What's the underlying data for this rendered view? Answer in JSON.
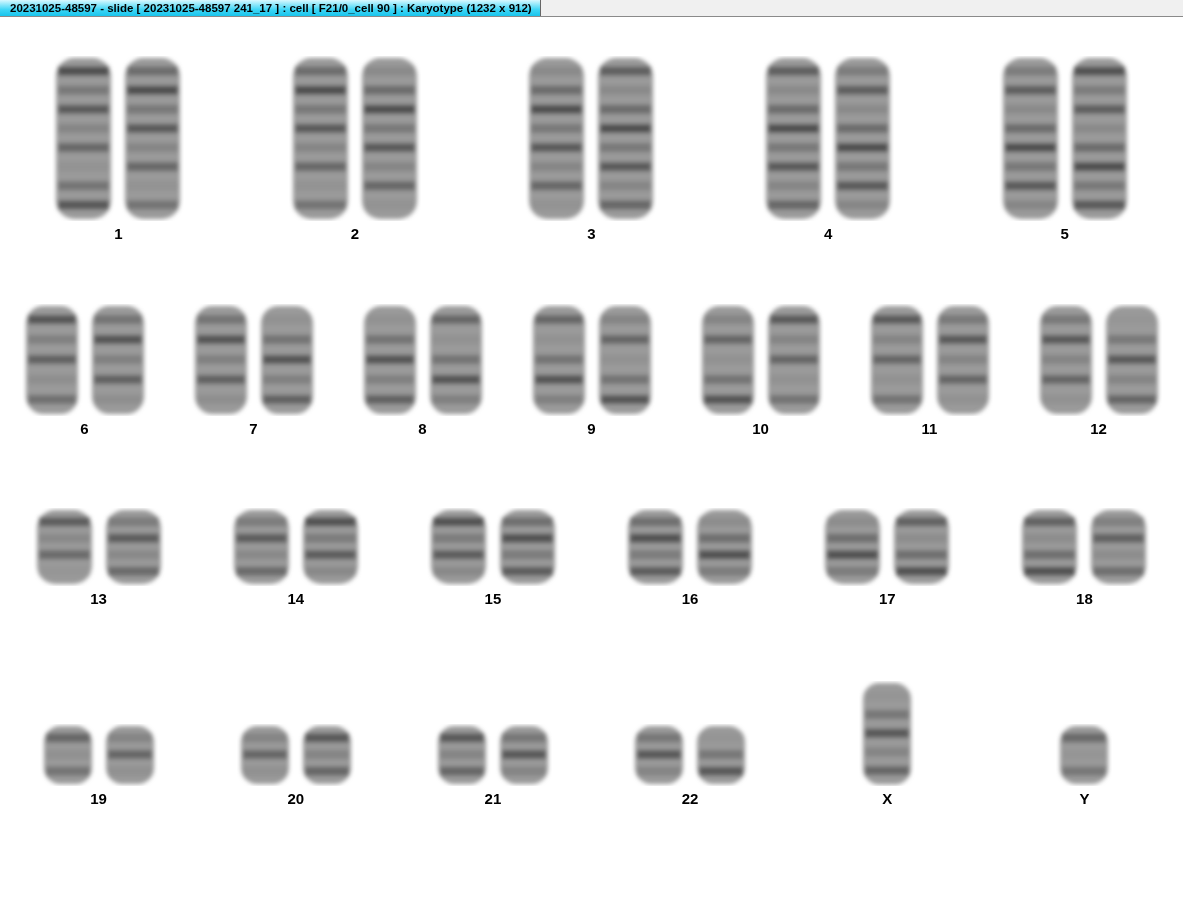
{
  "window": {
    "title": "20231025-48597 - slide [ 20231025-48597 241_17 ] : cell [ F21/0_cell 90 ] : Karyotype  (1232 x 912)"
  },
  "karyotype": {
    "rows": [
      {
        "items": [
          {
            "label": "1",
            "kind": "pair"
          },
          {
            "label": "2",
            "kind": "pair"
          },
          {
            "label": "3",
            "kind": "pair"
          },
          {
            "label": "4",
            "kind": "pair"
          },
          {
            "label": "5",
            "kind": "pair"
          }
        ]
      },
      {
        "items": [
          {
            "label": "6",
            "kind": "pair"
          },
          {
            "label": "7",
            "kind": "pair"
          },
          {
            "label": "8",
            "kind": "pair"
          },
          {
            "label": "9",
            "kind": "pair"
          },
          {
            "label": "10",
            "kind": "pair"
          },
          {
            "label": "11",
            "kind": "pair"
          },
          {
            "label": "12",
            "kind": "pair"
          }
        ]
      },
      {
        "items": [
          {
            "label": "13",
            "kind": "pair"
          },
          {
            "label": "14",
            "kind": "pair"
          },
          {
            "label": "15",
            "kind": "pair"
          },
          {
            "label": "16",
            "kind": "pair"
          },
          {
            "label": "17",
            "kind": "pair"
          },
          {
            "label": "18",
            "kind": "pair"
          }
        ]
      },
      {
        "items": [
          {
            "label": "19",
            "kind": "pair"
          },
          {
            "label": "20",
            "kind": "pair"
          },
          {
            "label": "21",
            "kind": "pair"
          },
          {
            "label": "22",
            "kind": "pair"
          },
          {
            "label": "X",
            "kind": "single"
          },
          {
            "label": "Y",
            "kind": "single"
          }
        ]
      }
    ]
  }
}
